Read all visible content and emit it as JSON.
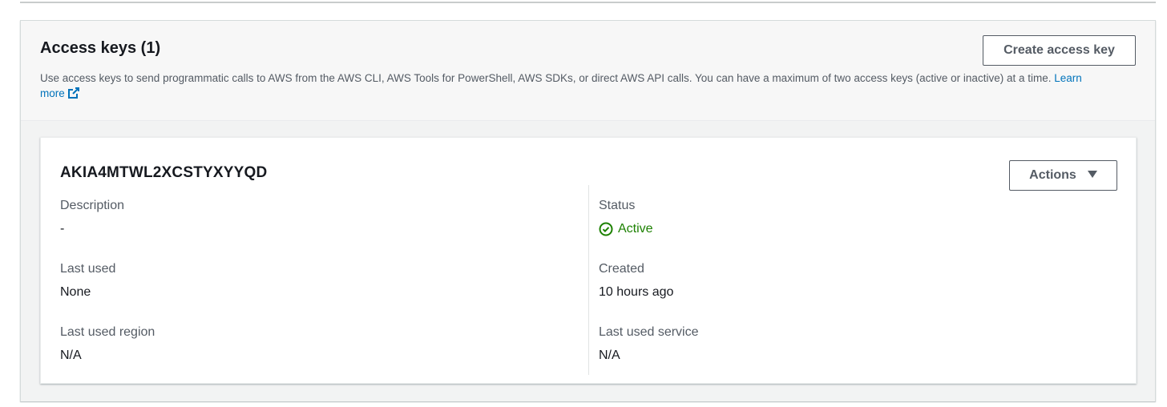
{
  "panel": {
    "title": "Access keys (1)",
    "description": "Use access keys to send programmatic calls to AWS from the AWS CLI, AWS Tools for PowerShell, AWS SDKs, or direct AWS API calls. You can have a maximum of two access keys (active or inactive) at a time.",
    "learn_more_label": "Learn more",
    "learn_more_icon": "external-link-icon",
    "create_button_label": "Create access key"
  },
  "access_key": {
    "id": "AKIA4MTWL2XCSTYXYYQD",
    "actions_label": "Actions",
    "actions_icon": "caret-down-icon",
    "fields": {
      "description": {
        "label": "Description",
        "value": "-"
      },
      "status": {
        "label": "Status",
        "value": "Active",
        "icon": "status-check-icon",
        "color": "#1d8102"
      },
      "last_used": {
        "label": "Last used",
        "value": "None"
      },
      "created": {
        "label": "Created",
        "value": "10 hours ago"
      },
      "last_used_region": {
        "label": "Last used region",
        "value": "N/A"
      },
      "last_used_service": {
        "label": "Last used service",
        "value": "N/A"
      }
    }
  },
  "colors": {
    "link": "#0073bb",
    "status_active": "#1d8102",
    "button_text": "#545b64"
  }
}
